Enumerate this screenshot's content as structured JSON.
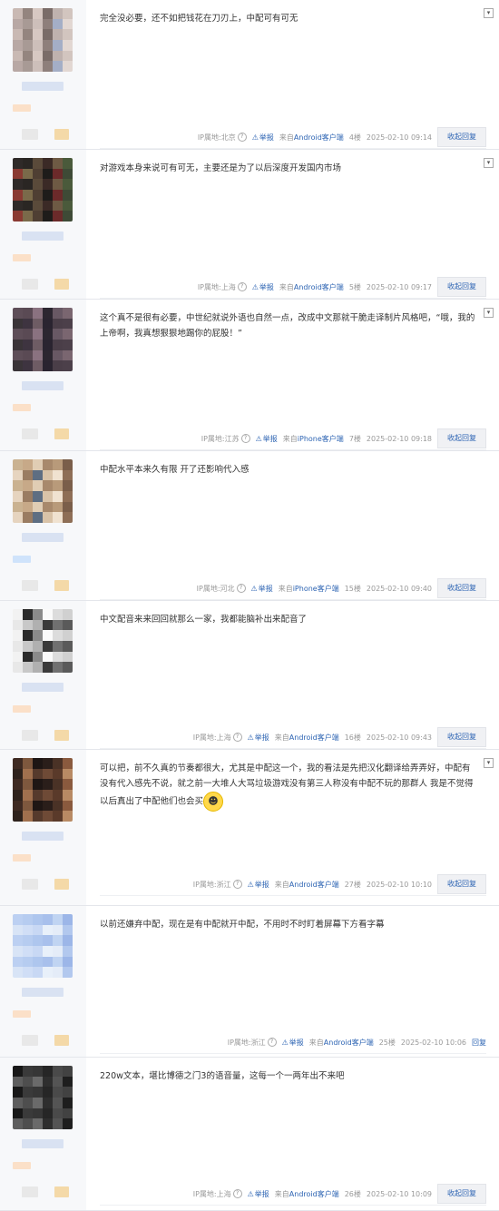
{
  "posts": [
    {
      "content": "完全没必要，还不如把钱花在刀刃上，中配可有可无",
      "ip": "IP属地:北京",
      "client": "Android客户端",
      "floor": "4楼",
      "time": "2025-02-10 09:14",
      "has_more": true
    },
    {
      "content": "对游戏本身来说可有可无，主要还是为了以后深度开发国内市场",
      "ip": "IP属地:上海",
      "client": "Android客户端",
      "floor": "5楼",
      "time": "2025-02-10 09:17",
      "has_more": true
    },
    {
      "content": "这个真不是很有必要，中世纪就说外语也自然一点，改成中文那就干脆走译制片风格吧，“哦，我的上帝啊，我真想狠狠地踢你的屁股！”",
      "ip": "IP属地:江苏",
      "client": "iPhone客户端",
      "floor": "7楼",
      "time": "2025-02-10 09:18",
      "has_more": true
    },
    {
      "content": "中配水平本来久有限 开了还影响代入感",
      "ip": "IP属地:河北",
      "client": "iPhone客户端",
      "floor": "15楼",
      "time": "2025-02-10 09:40",
      "has_more": false
    },
    {
      "content": "中文配音来来回回就那么一家，我都能脑补出来配音了",
      "ip": "IP属地:上海",
      "client": "Android客户端",
      "floor": "16楼",
      "time": "2025-02-10 09:43",
      "has_more": false
    },
    {
      "content": "可以把，前不久真的节奏都很大，尤其是中配这一个，我的看法是先把汉化翻译给弄弄好，中配有没有代入感先不说，就之前一大堆人大骂垃圾游戏没有第三人称没有中配不玩的那群人 我是不觉得以后真出了中配他们也会买",
      "ip": "IP属地:浙江",
      "client": "Android客户端",
      "floor": "27楼",
      "time": "2025-02-10 10:10",
      "has_more": true,
      "emoji": true
    },
    {
      "content": "以前还嫌弃中配，现在是有中配就开中配，不用时不时盯着屏幕下方看字幕",
      "ip": "IP属地:浙江",
      "client": "Android客户端",
      "floor": "25楼",
      "time": "2025-02-10 10:06",
      "has_more": false,
      "reply_short": true
    },
    {
      "content": "220w文本，堪比博德之门3的语音量，这每一个一两年出不来吧",
      "ip": "IP属地:上海",
      "client": "Android客户端",
      "floor": "26楼",
      "time": "2025-02-10 10:09",
      "has_more": false
    }
  ],
  "labels": {
    "report": "举报",
    "from": "来自",
    "reply": "收起回复",
    "reply_short": "回复",
    "help": "?",
    "more": "▾"
  },
  "colors": {
    "link": "#2d64b3",
    "meta": "#999999",
    "sidebar": "#f7f8fa"
  }
}
